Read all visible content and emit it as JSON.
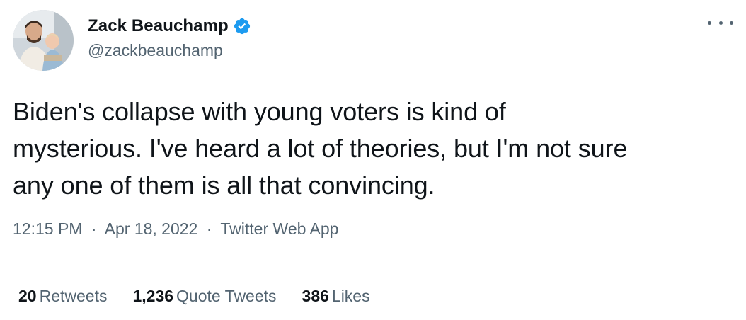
{
  "author": {
    "display_name": "Zack Beauchamp",
    "handle": "@zackbeauchamp",
    "verified": true,
    "verified_color": "#1d9bf0"
  },
  "tweet": {
    "text": "Biden's collapse with young voters is kind of\nmysterious. I've heard a lot of theories, but I'm not sure\nany one of them is all that convincing.",
    "time": "12:15 PM",
    "date": "Apr 18, 2022",
    "source": "Twitter Web App",
    "separator": "·"
  },
  "stats": {
    "retweets_count": "20",
    "retweets_label": "Retweets",
    "quotes_count": "1,236",
    "quotes_label": "Quote Tweets",
    "likes_count": "386",
    "likes_label": "Likes"
  },
  "icons": {
    "verified": "verified-badge-icon",
    "more": "more-horizontal-icon"
  },
  "colors": {
    "text_primary": "#0f1419",
    "text_secondary": "#536471",
    "divider": "#eff3f4"
  }
}
